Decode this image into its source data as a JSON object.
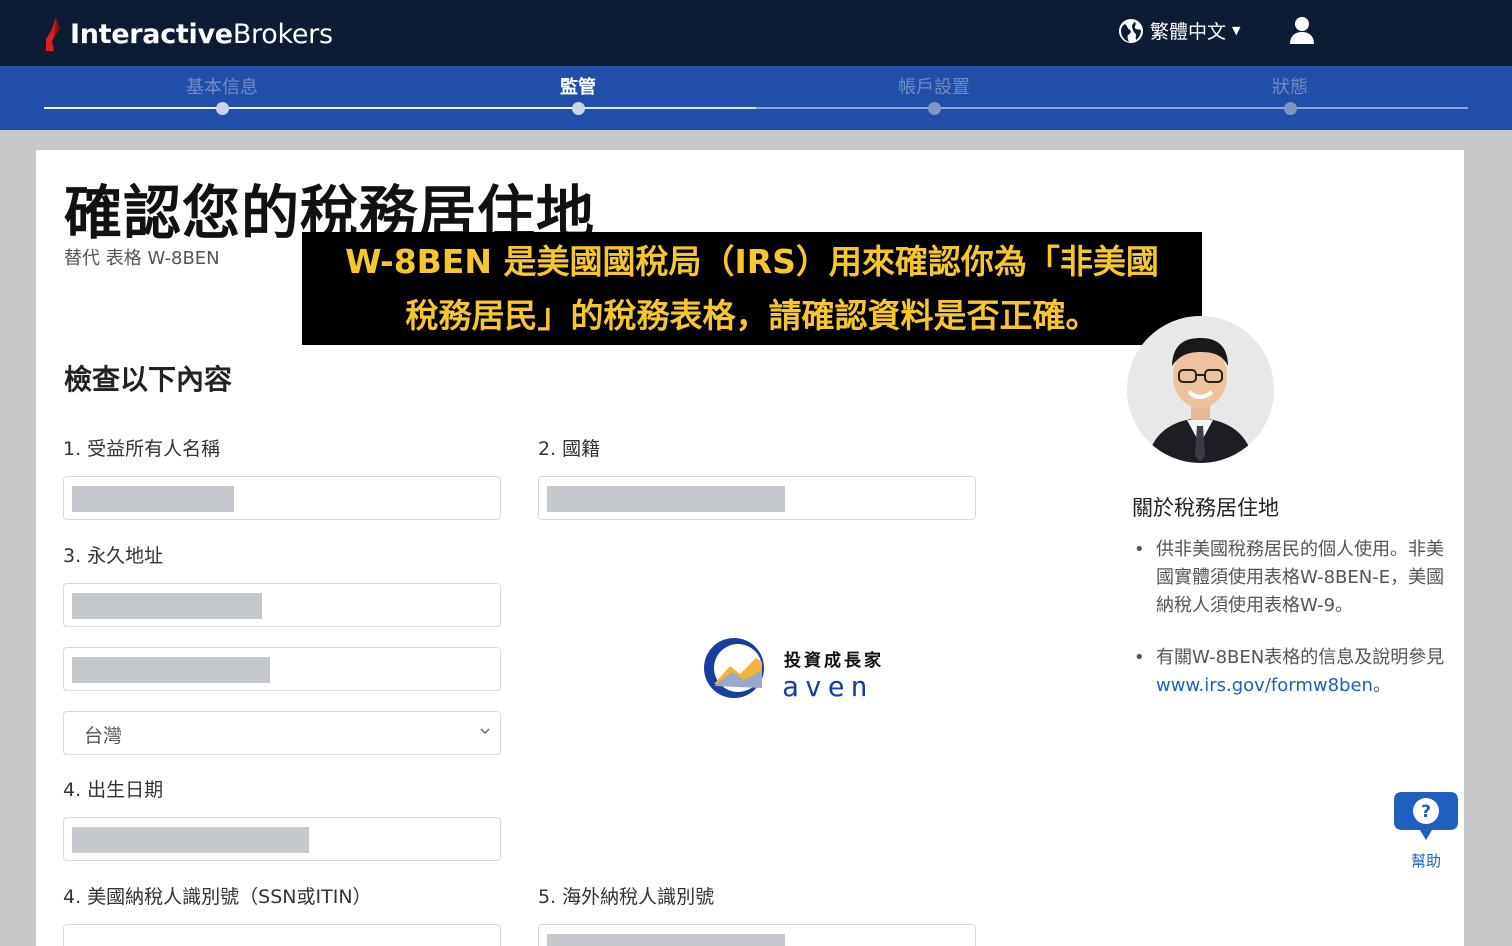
{
  "header": {
    "logo_bold": "Interactive",
    "logo_light": "Brokers",
    "language": "繁體中文"
  },
  "steps": [
    {
      "label": "基本信息",
      "state": "done"
    },
    {
      "label": "監管",
      "state": "active"
    },
    {
      "label": "帳戶設置",
      "state": "todo"
    },
    {
      "label": "狀態",
      "state": "todo"
    }
  ],
  "page": {
    "title": "確認您的稅務居住地",
    "subtitle": "替代 表格 W-8BEN",
    "section": "檢查以下內容"
  },
  "form": {
    "beneficial_owner_label": "1. 受益所有人名稱",
    "citizenship_label": "2. 國籍",
    "address_label": "3. 永久地址",
    "country_value": "台灣",
    "dob_label": "4. 出生日期",
    "us_tin_label": "4. 美國納稅人識別號（SSN或ITIN）",
    "foreign_tin_label": "5. 海外納稅人識別號"
  },
  "about": {
    "title": "關於稅務居住地",
    "bullet1": "供非美國稅務居民的個人使用。非美國實體須使用表格W-8BEN-E，美國納稅人須使用表格W-9。",
    "bullet2_prefix": "有關W-8BEN表格的信息及說明參見",
    "bullet2_link": "www.irs.gov/formw8ben",
    "bullet2_suffix": "。"
  },
  "help": {
    "label": "幫助"
  },
  "overlay": {
    "banner_line1": "W-8BEN 是美國國稅局（IRS）用來確認你為「非美國",
    "banner_line2": "稅務居民」的稅務表格，請確認資料是否正確。",
    "brand_cn": "投資成長家",
    "brand_en": "aven"
  },
  "colors": {
    "topbar": "#0d1b33",
    "progress_bar": "#1f4fa8",
    "banner_text": "#f7c62f",
    "link": "#1f5fbf",
    "logo_red": "#d81f26"
  }
}
